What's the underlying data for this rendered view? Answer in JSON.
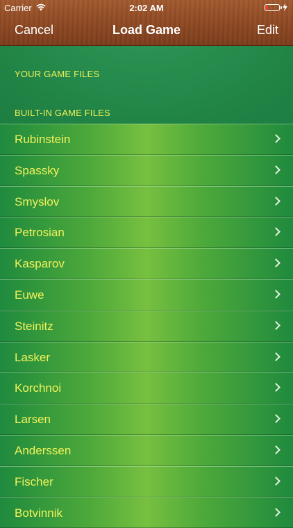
{
  "status": {
    "carrier": "Carrier",
    "time": "2:02 AM"
  },
  "nav": {
    "cancel": "Cancel",
    "title": "Load Game",
    "edit": "Edit"
  },
  "sections": {
    "your_files": "YOUR GAME FILES",
    "builtin_files": "BUILT-IN GAME FILES"
  },
  "games": [
    "Rubinstein",
    "Spassky",
    "Smyslov",
    "Petrosian",
    "Kasparov",
    "Euwe",
    "Steinitz",
    "Lasker",
    "Korchnoi",
    "Larsen",
    "Anderssen",
    "Fischer",
    "Botvinnik"
  ],
  "colors": {
    "label": "#f3f25a",
    "header": "#eef05a",
    "nav_wood": "#8f4a24"
  }
}
